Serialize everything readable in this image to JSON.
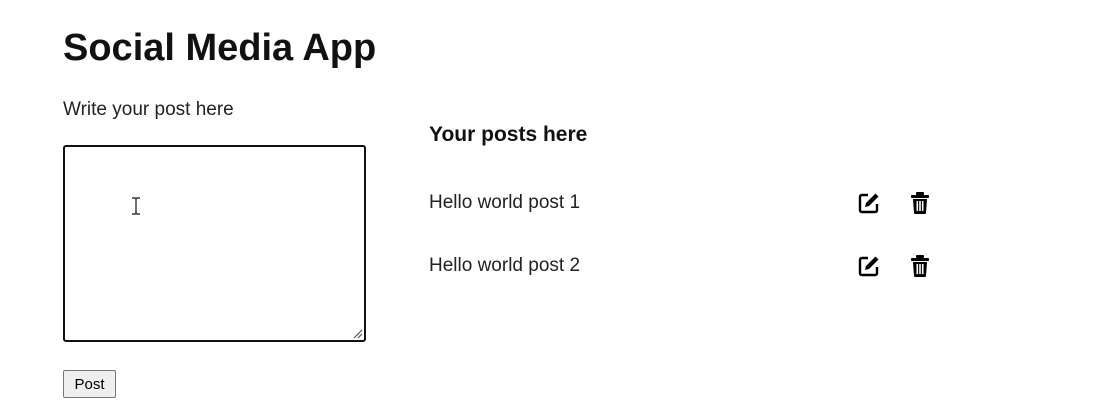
{
  "app": {
    "title": "Social Media App"
  },
  "compose": {
    "label": "Write your post here",
    "value": "",
    "placeholder": "",
    "button_label": "Post"
  },
  "posts_section": {
    "heading": "Your posts here",
    "posts": [
      {
        "text": "Hello world post 1",
        "edit_icon": "edit-icon",
        "delete_icon": "trash-icon"
      },
      {
        "text": "Hello world post 2",
        "edit_icon": "edit-icon",
        "delete_icon": "trash-icon"
      }
    ]
  },
  "colors": {
    "text": "#111111",
    "border": "#111111",
    "button_bg": "#efefef",
    "button_border": "#767676"
  }
}
